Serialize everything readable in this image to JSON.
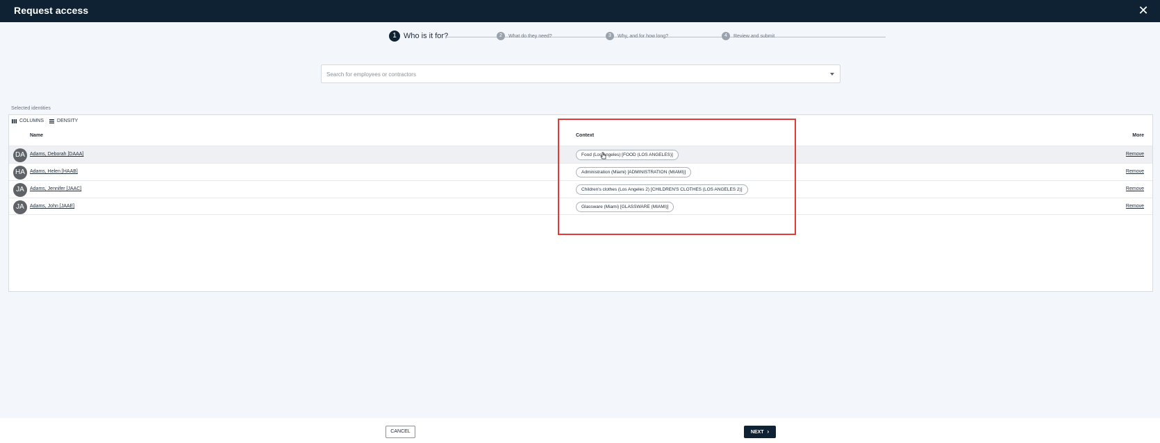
{
  "window": {
    "title": "Request access",
    "close_icon": "close-icon"
  },
  "stepper": {
    "steps": [
      {
        "num": "1",
        "label": "Who is it for?"
      },
      {
        "num": "2",
        "label": "What do they need?"
      },
      {
        "num": "3",
        "label": "Why, and for how long?"
      },
      {
        "num": "4",
        "label": "Review and submit"
      }
    ]
  },
  "search": {
    "placeholder": "Search for employees or contractors"
  },
  "selected": {
    "label": "Selected identities",
    "toolbar": {
      "columns": "COLUMNS",
      "density": "DENSITY"
    },
    "headers": {
      "name": "Name",
      "context": "Context",
      "more": "More"
    },
    "rows": [
      {
        "initials": "DA",
        "name": "Adams, Deborah [DAAA]",
        "context": "Food (Los Angeles) [FOOD (LOS ANGELES)]",
        "action": "Remove"
      },
      {
        "initials": "HA",
        "name": "Adams, Helen [HAAB]",
        "context": "Administration (Miami) [ADMINISTRATION (MIAMI)]",
        "action": "Remove"
      },
      {
        "initials": "JA",
        "name": "Adams, Jennifer [JAAC]",
        "context": "Children's clothes (Los Angeles 2) [CHILDREN'S CLOTHES (LOS ANGELES 2)]",
        "action": "Remove"
      },
      {
        "initials": "JA",
        "name": "Adams, John [JAAE]",
        "context": "Glassware (Miami) [GLASSWARE (MIAMI)]",
        "action": "Remove"
      }
    ]
  },
  "footer": {
    "cancel": "CANCEL",
    "next": "NEXT",
    "next_icon": "chevron-right-icon"
  },
  "colors": {
    "header_bg": "#0f2233",
    "highlight": "#e53935",
    "avatar": "#5f6368"
  }
}
